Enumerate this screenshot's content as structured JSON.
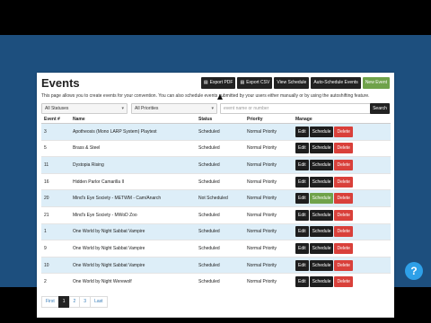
{
  "page": {
    "title": "Events",
    "description": "This page allows you to create events for your convention. You can also schedule events submitted by your users either manually or by using the autoshifting feature."
  },
  "toolbar": {
    "export_pdf": "Export PDF",
    "export_csv": "Export CSV",
    "view_schedule": "View Schedule",
    "auto_schedule": "Auto-Schedule Events",
    "new_event": "New Event"
  },
  "filters": {
    "status": "All Statuses",
    "priority": "All Priorities",
    "search_placeholder": "event name or number",
    "search_button": "Search"
  },
  "table": {
    "headers": [
      "Event #",
      "Name",
      "Status",
      "Priority",
      "Manage"
    ],
    "rows": [
      {
        "num": "3",
        "name": "Apotheosis (Mono LARP System) Playtest",
        "status": "Scheduled",
        "priority": "Normal Priority"
      },
      {
        "num": "5",
        "name": "Brass & Steel",
        "status": "Scheduled",
        "priority": "Normal Priority"
      },
      {
        "num": "11",
        "name": "Dystopia Rising",
        "status": "Scheduled",
        "priority": "Normal Priority"
      },
      {
        "num": "16",
        "name": "Hidden Parlor Camarilla II",
        "status": "Scheduled",
        "priority": "Normal Priority"
      },
      {
        "num": "20",
        "name": "Mind's Eye Society - METWM - Cam/Anarch",
        "status": "Not Scheduled",
        "priority": "Normal Priority"
      },
      {
        "num": "21",
        "name": "Mind's Eye Society - MWoD Zoo",
        "status": "Scheduled",
        "priority": "Normal Priority"
      },
      {
        "num": "1",
        "name": "One World by Night Sabbat Vampire",
        "status": "Scheduled",
        "priority": "Normal Priority"
      },
      {
        "num": "9",
        "name": "One World by Night Sabbat Vampire",
        "status": "Scheduled",
        "priority": "Normal Priority"
      },
      {
        "num": "10",
        "name": "One World by Night Sabbat Vampire",
        "status": "Scheduled",
        "priority": "Normal Priority"
      },
      {
        "num": "2",
        "name": "One World by Night Werewolf",
        "status": "Scheduled",
        "priority": "Normal Priority"
      }
    ],
    "actions": {
      "edit": "Edit",
      "schedule": "Schedule",
      "delete": "Delete"
    }
  },
  "pagination": {
    "first": "First",
    "pages": [
      "1",
      "2",
      "3"
    ],
    "active": "1",
    "last": "Last"
  },
  "help": {
    "label": "?"
  }
}
